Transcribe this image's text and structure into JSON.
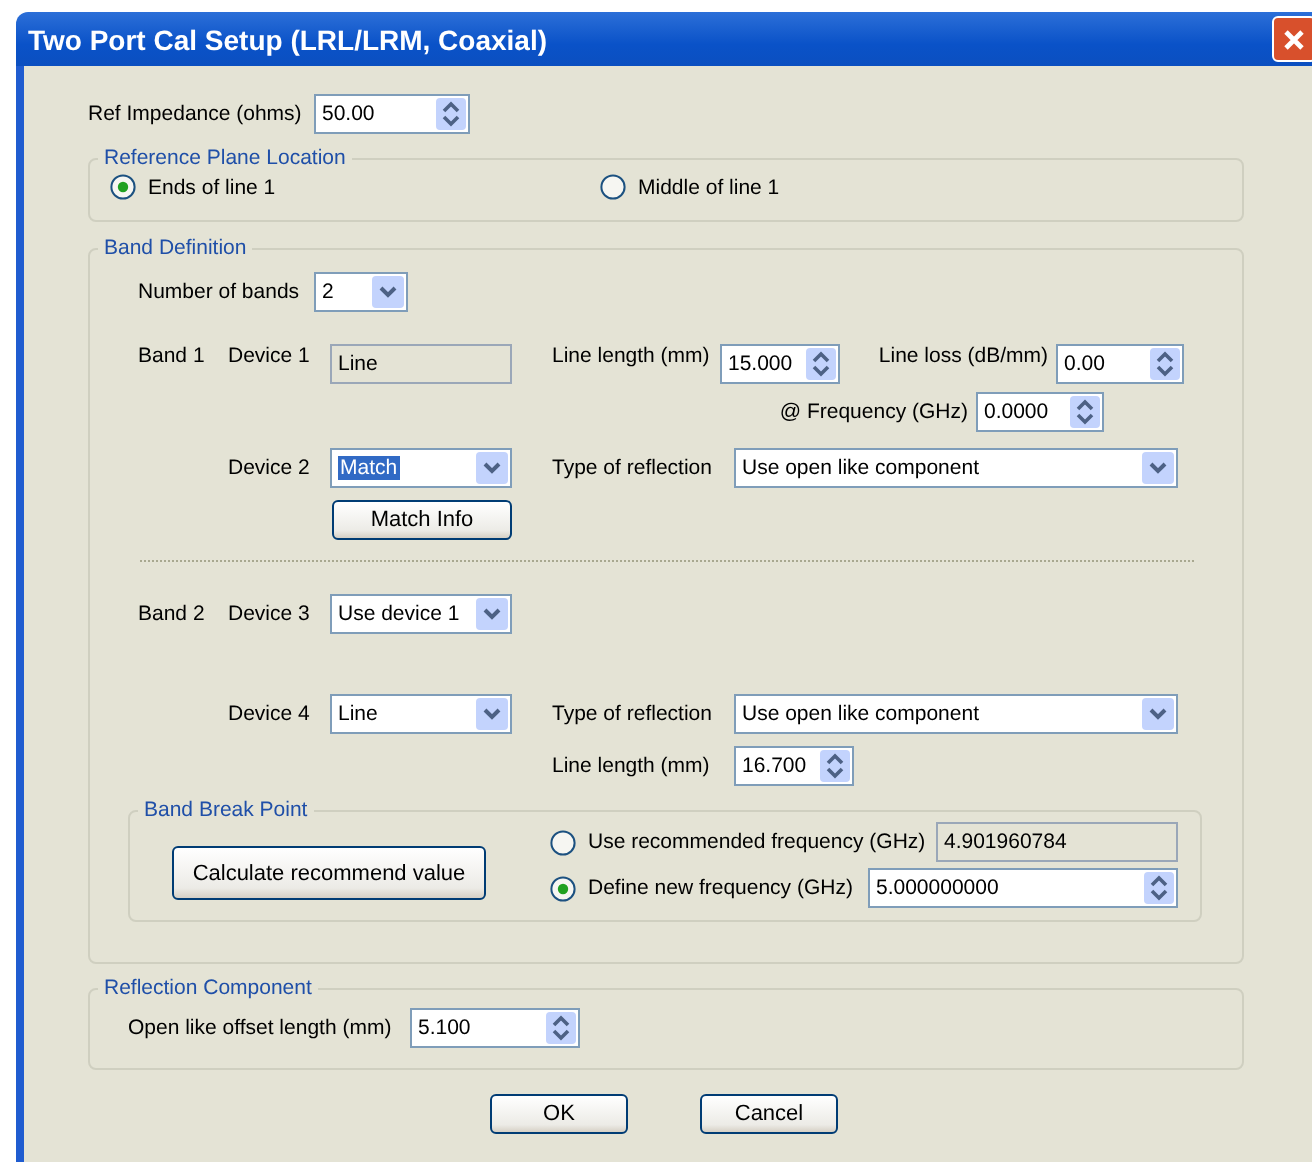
{
  "window": {
    "title": "Two Port Cal Setup (LRL/LRM, Coaxial)"
  },
  "ref_impedance": {
    "label": "Ref Impedance (ohms)",
    "field": {
      "kind": "spin",
      "value": "50.00"
    }
  },
  "reference_plane": {
    "title": "Reference Plane Location",
    "options": [
      {
        "label": "Ends of line 1",
        "selected": true
      },
      {
        "label": "Middle of line 1",
        "selected": false
      }
    ]
  },
  "band_definition": {
    "title": "Band Definition",
    "number_of_bands": {
      "label": "Number of bands",
      "field": {
        "kind": "combo",
        "value": "2"
      }
    },
    "band_1": {
      "label": "Band 1",
      "device_1": {
        "label": "Device 1",
        "field": {
          "kind": "readonly",
          "value": "Line"
        }
      },
      "line_length": {
        "label": "Line length (mm)",
        "field": {
          "kind": "spin",
          "value": "15.000"
        }
      },
      "line_loss": {
        "label": "Line loss (dB/mm)",
        "field": {
          "kind": "spin",
          "value": "0.00"
        }
      },
      "frequency": {
        "label": "@ Frequency (GHz)",
        "field": {
          "kind": "spin",
          "value": "0.0000"
        }
      },
      "device_2": {
        "label": "Device 2",
        "field": {
          "kind": "combo",
          "value": "Match",
          "highlighted": true
        }
      },
      "type_of_reflection": {
        "label": "Type of reflection",
        "field": {
          "kind": "combo",
          "value": "Use open like component"
        }
      },
      "match_info_button": "Match Info"
    },
    "band_2": {
      "label": "Band 2",
      "device_3": {
        "label": "Device 3",
        "field": {
          "kind": "combo",
          "value": "Use device 1"
        }
      },
      "device_4": {
        "label": "Device 4",
        "field": {
          "kind": "combo",
          "value": "Line"
        }
      },
      "type_of_reflection": {
        "label": "Type of reflection",
        "field": {
          "kind": "combo",
          "value": "Use open like component"
        }
      },
      "line_length": {
        "label": "Line length (mm)",
        "field": {
          "kind": "spin",
          "value": "16.700"
        }
      }
    },
    "band_break_point": {
      "title": "Band Break Point",
      "calculate_button": "Calculate recommend value",
      "options": [
        {
          "label": "Use recommended frequency (GHz)",
          "selected": false,
          "field": {
            "kind": "readonly",
            "value": "4.901960784"
          }
        },
        {
          "label": "Define new frequency (GHz)",
          "selected": true,
          "field": {
            "kind": "spin",
            "value": "5.000000000"
          }
        }
      ]
    }
  },
  "reflection_component": {
    "title": "Reflection Component",
    "offset_length": {
      "label": "Open like offset length (mm)",
      "field": {
        "kind": "spin",
        "value": "5.100"
      }
    }
  },
  "buttons": [
    "OK",
    "Cancel"
  ]
}
